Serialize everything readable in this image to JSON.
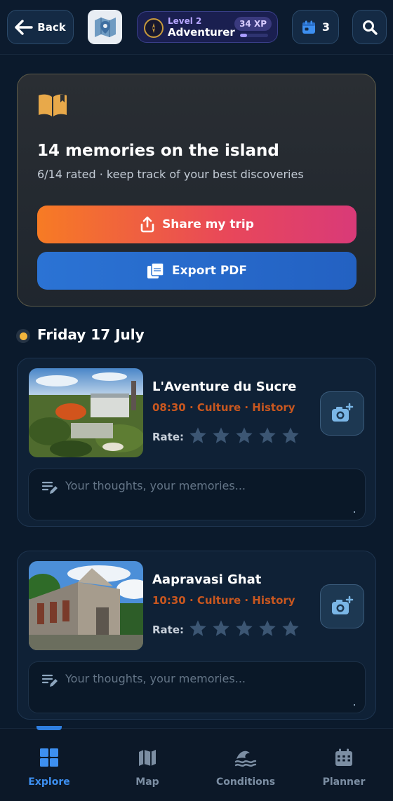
{
  "header": {
    "back_label": "Back",
    "level_label": "Level 2",
    "rank_label": "Adventurer",
    "xp_label": "34 XP",
    "xp_progress": 0.24,
    "planner_count": "3"
  },
  "summary": {
    "title": "14 memories on the island",
    "subtitle": "6/14 rated · keep track of your best discoveries",
    "share_label": "Share my trip",
    "export_label": "Export PDF"
  },
  "day": {
    "title": "Friday 17 July"
  },
  "activities": [
    {
      "name": "L'Aventure du Sucre",
      "meta": "08:30 · Culture · History",
      "rate_label": "Rate:",
      "rating": 0,
      "note_placeholder": "Your thoughts, your memories..."
    },
    {
      "name": "Aapravasi Ghat",
      "meta": "10:30 · Culture · History",
      "rate_label": "Rate:",
      "rating": 0,
      "note_placeholder": "Your thoughts, your memories..."
    }
  ],
  "nav": {
    "items": [
      {
        "label": "Explore",
        "icon": "grid-icon",
        "active": true
      },
      {
        "label": "Map",
        "icon": "map-icon",
        "active": false
      },
      {
        "label": "Conditions",
        "icon": "waves-icon",
        "active": false
      },
      {
        "label": "Planner",
        "icon": "calendar-icon",
        "active": false
      }
    ]
  },
  "colors": {
    "background": "#0b1a2c",
    "accent_orange": "#c9571f",
    "star_empty": "#3c5673",
    "nav_active": "#3d8ff0",
    "day_dot": "#f1b43c"
  }
}
